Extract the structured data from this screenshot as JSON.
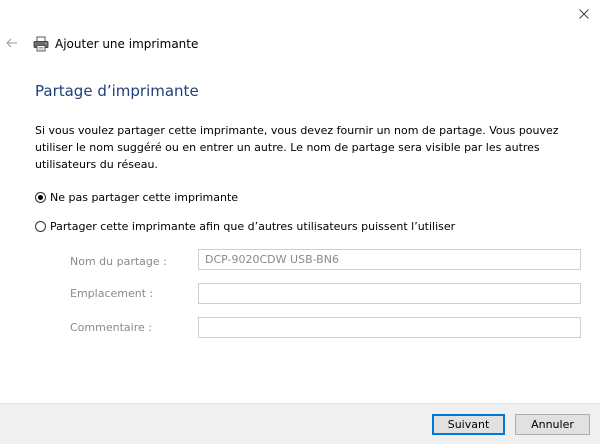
{
  "window": {
    "header_title": "Ajouter une imprimante",
    "page_title": "Partage d’imprimante",
    "description": "Si vous voulez partager cette imprimante, vous devez fournir un nom de partage. Vous pouvez utiliser le nom suggéré ou en entrer un autre. Le nom de partage sera visible par les autres utilisateurs du réseau."
  },
  "options": {
    "no_share": {
      "label": "Ne pas partager cette imprimante",
      "selected": true
    },
    "share": {
      "label": "Partager cette imprimante afin que d’autres utilisateurs puissent l’utiliser",
      "selected": false
    }
  },
  "fields": {
    "share_name": {
      "label": "Nom du partage :",
      "value": "DCP-9020CDW USB-BN6"
    },
    "location": {
      "label": "Emplacement :",
      "value": ""
    },
    "comment": {
      "label": "Commentaire :",
      "value": ""
    }
  },
  "footer": {
    "next_label": "Suivant",
    "cancel_label": "Annuler"
  },
  "icons": {
    "close": "close-icon",
    "back": "back-arrow-icon",
    "printer": "printer-icon"
  },
  "colors": {
    "title": "#1e3f7a",
    "accent": "#0078d7",
    "disabled_text": "#8a8a8a",
    "footer_bg": "#f0f0f0"
  }
}
